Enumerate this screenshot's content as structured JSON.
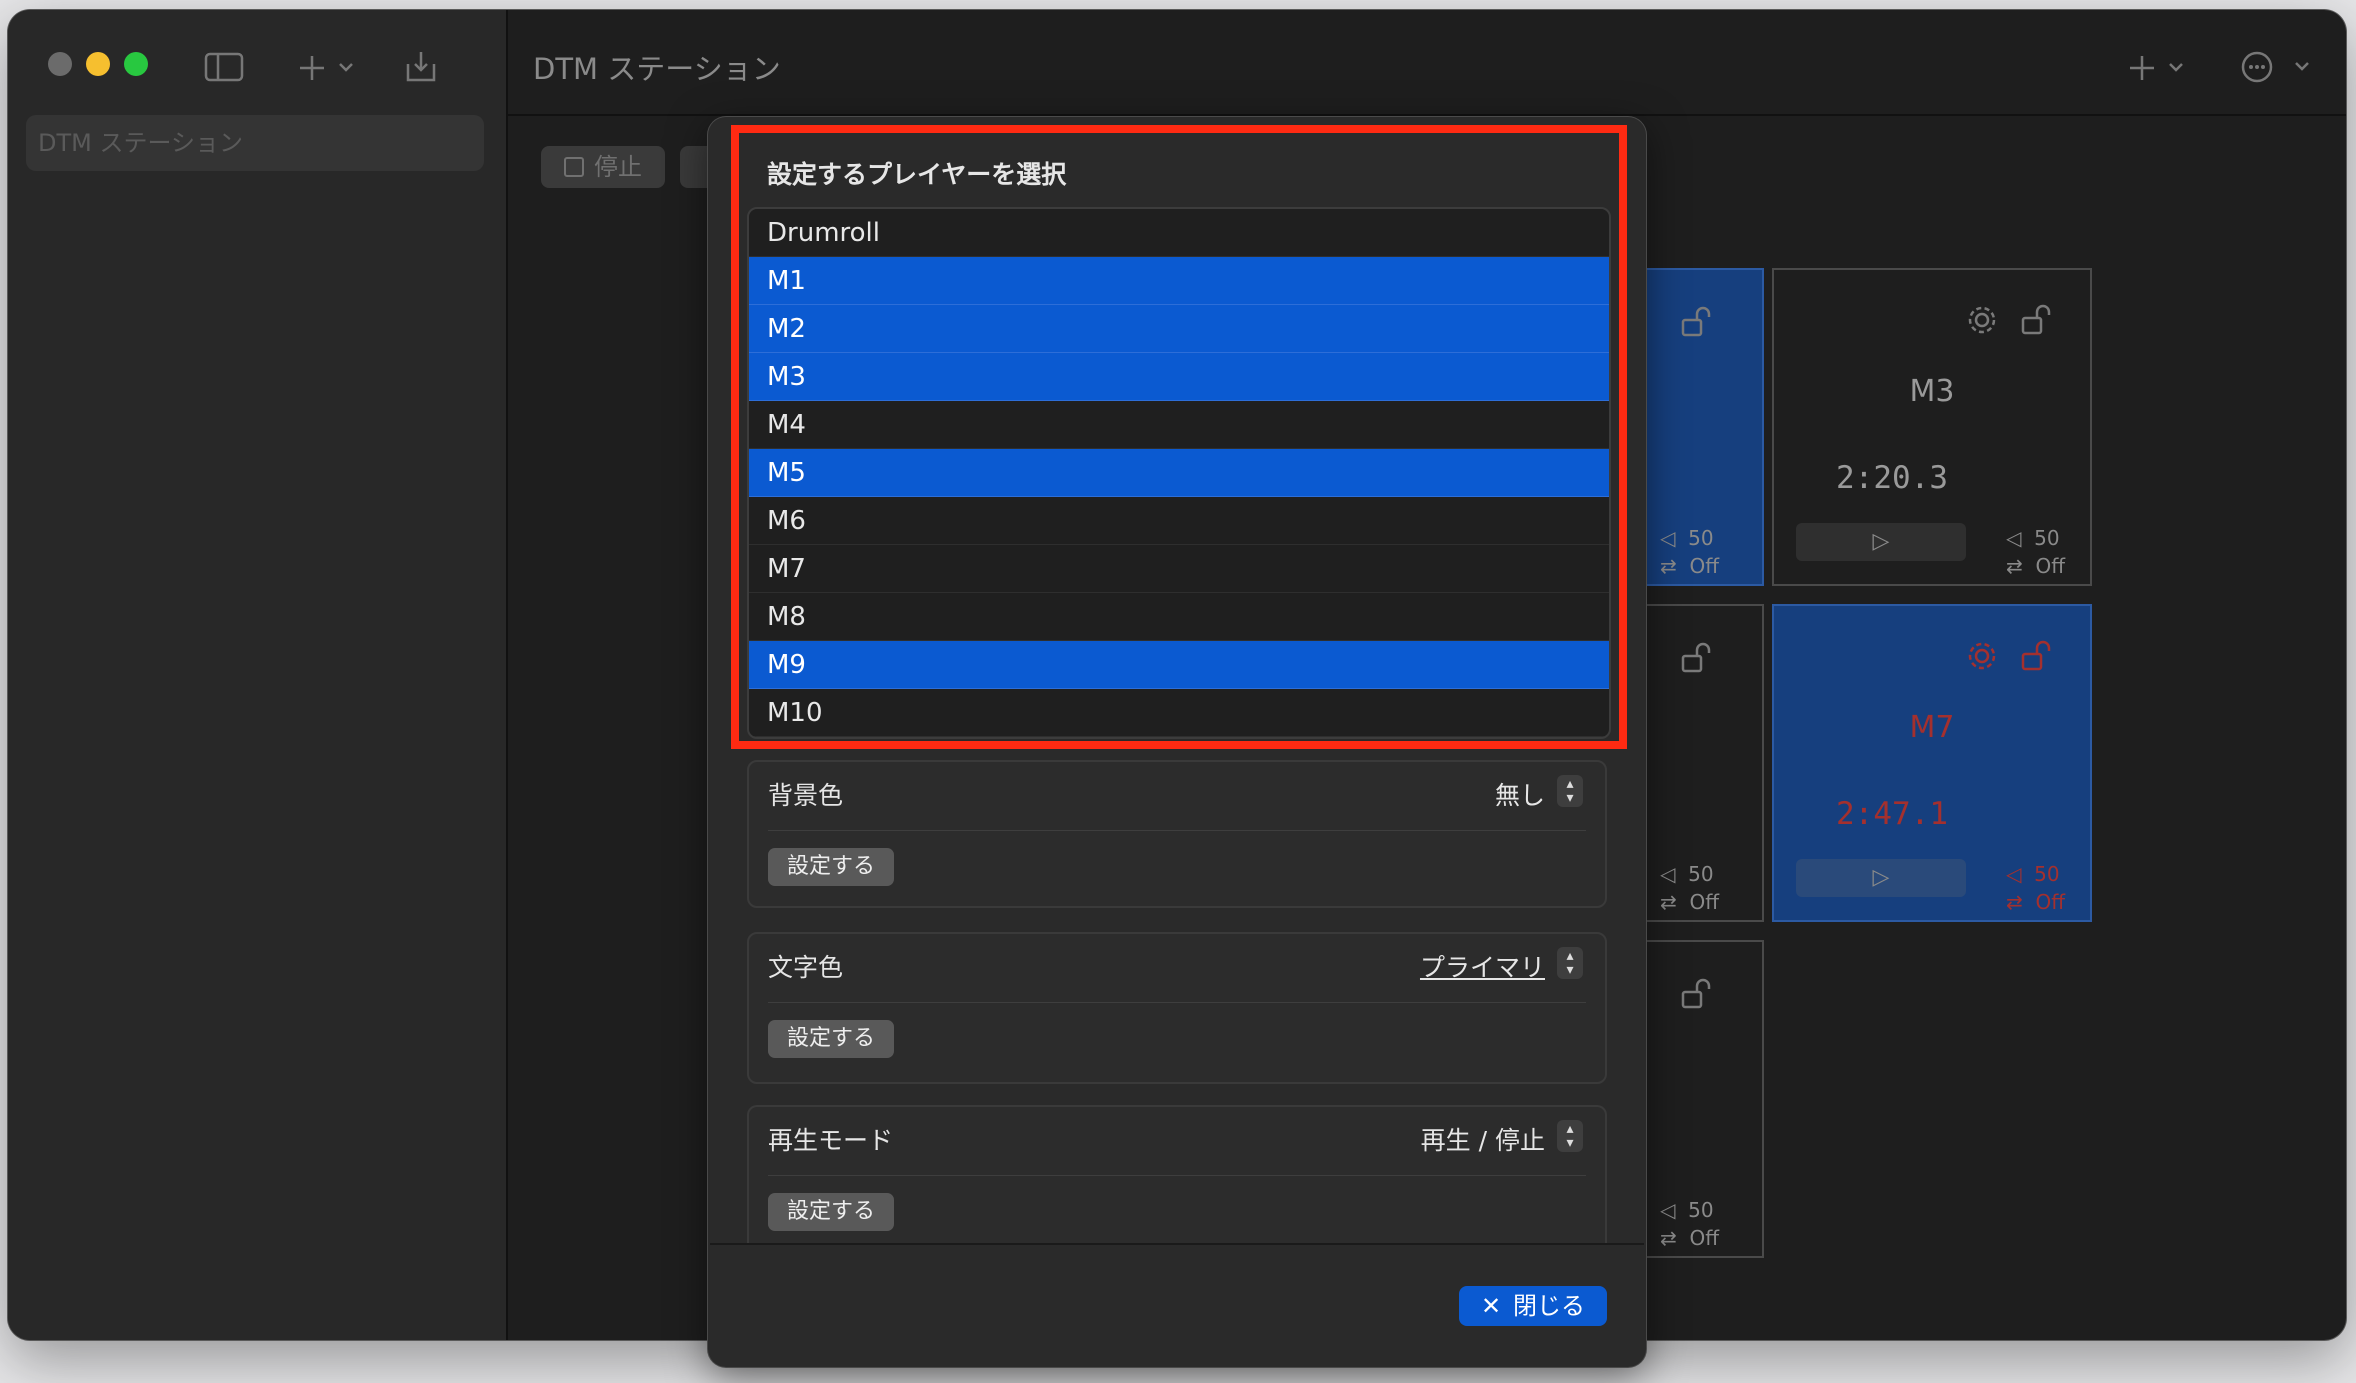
{
  "window": {
    "title": "DTM ステーション"
  },
  "sidebar": {
    "item": "DTM ステーション"
  },
  "toolbar": {
    "stop_label": "停止"
  },
  "tiles": [
    {
      "meta_volume": "50",
      "meta_repeat": "Off"
    },
    {
      "name": "M3",
      "time": "2:20.3",
      "meta_volume": "50",
      "meta_repeat": "Off"
    },
    {
      "meta_volume": "50",
      "meta_repeat": "Off"
    },
    {
      "name": "M7",
      "time": "2:47.1",
      "meta_volume": "50",
      "meta_repeat": "Off"
    },
    {
      "meta_volume": "50",
      "meta_repeat": "Off"
    }
  ],
  "modal": {
    "select_title": "設定するプレイヤーを選択",
    "players": [
      {
        "label": "Drumroll",
        "selected": false
      },
      {
        "label": "M1",
        "selected": true
      },
      {
        "label": "M2",
        "selected": true
      },
      {
        "label": "M3",
        "selected": true
      },
      {
        "label": "M4",
        "selected": false
      },
      {
        "label": "M5",
        "selected": true
      },
      {
        "label": "M6",
        "selected": false
      },
      {
        "label": "M7",
        "selected": false
      },
      {
        "label": "M8",
        "selected": false
      },
      {
        "label": "M9",
        "selected": true
      },
      {
        "label": "M10",
        "selected": false
      }
    ],
    "background": {
      "title": "背景色",
      "value": "無し",
      "button": "設定する"
    },
    "text_color": {
      "title": "文字色",
      "value": "プライマリ",
      "button": "設定する"
    },
    "play_mode": {
      "title": "再生モード",
      "value": "再生 / 停止",
      "button": "設定する"
    },
    "close_label": "閉じる"
  },
  "colors": {
    "accent": "#0b5ad1",
    "highlight": "#ff2a12",
    "red_text": "#a4302e"
  }
}
